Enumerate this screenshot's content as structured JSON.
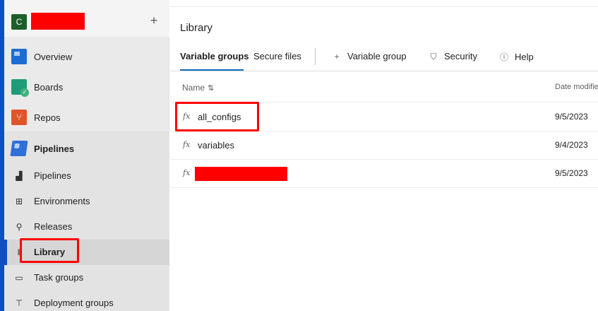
{
  "project": {
    "avatar_letter": "C"
  },
  "sidebar": {
    "items": [
      {
        "label": "Overview"
      },
      {
        "label": "Boards"
      },
      {
        "label": "Repos"
      },
      {
        "label": "Pipelines"
      }
    ],
    "pipelines_sub": [
      {
        "label": "Pipelines"
      },
      {
        "label": "Environments"
      },
      {
        "label": "Releases"
      },
      {
        "label": "Library"
      },
      {
        "label": "Task groups"
      },
      {
        "label": "Deployment groups"
      }
    ],
    "add_label": "+"
  },
  "main": {
    "title": "Library",
    "tabs": [
      {
        "label": "Variable groups"
      },
      {
        "label": "Secure files"
      }
    ],
    "commands": [
      {
        "icon": "plus-icon",
        "label": "Variable group"
      },
      {
        "icon": "shield-icon",
        "label": "Security"
      },
      {
        "icon": "help-icon",
        "label": "Help"
      }
    ],
    "columns": {
      "name": "Name",
      "date": "Date modified"
    },
    "rows": [
      {
        "name": "all_configs",
        "date": "9/5/2023"
      },
      {
        "name": "variables",
        "date": "9/4/2023"
      },
      {
        "name": "",
        "date": "9/5/2023"
      }
    ],
    "fx_glyph": "fx"
  },
  "colors": {
    "accent": "#0f4fc4",
    "highlight": "#ff0000"
  }
}
